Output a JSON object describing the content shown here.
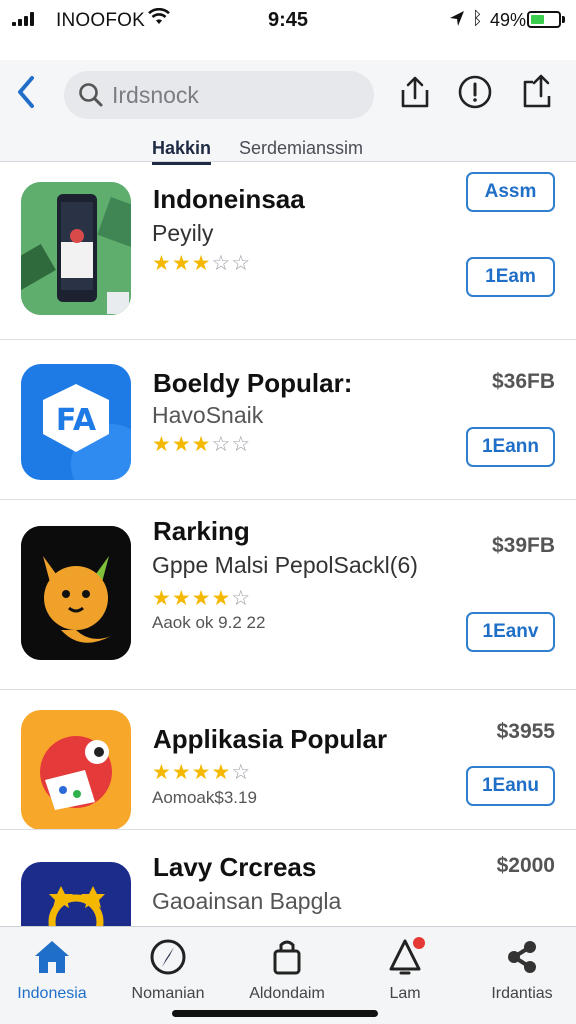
{
  "status_bar": {
    "carrier": "INOOFOK",
    "time": "9:45",
    "battery_pct": "49%",
    "battery_level": 0.49
  },
  "nav": {
    "search_value": "Irdsnock"
  },
  "tabs": [
    {
      "label": "Hakkin",
      "active": true
    },
    {
      "label": "Serdemianssim",
      "active": false
    }
  ],
  "apps": [
    {
      "title": "Indoneinsaa",
      "subtitle": "Peyily",
      "rating": 3,
      "meta": "",
      "price": "",
      "buttons": [
        "Assm",
        "1Eam"
      ]
    },
    {
      "title": "Boeldy Popular:",
      "subtitle": "HavoSnaik",
      "rating": 3,
      "meta": "",
      "price": "$36FB",
      "buttons": [
        "1Eann"
      ]
    },
    {
      "title": "Rarking",
      "subtitle": "Gppe Malsi PepolSackl(6)",
      "rating": 4,
      "meta": "Aaok ok 9.2 22",
      "price": "$39FB",
      "buttons": [
        "1Eanv"
      ]
    },
    {
      "title": "Applikasia Popular",
      "subtitle": "",
      "rating": 4,
      "meta": "Aomoak$3.19",
      "price": "$3955",
      "buttons": [
        "1Eanu"
      ]
    },
    {
      "title": "Lavy Crcreas",
      "subtitle": "Gaoainsan Bapgla",
      "rating": 0,
      "meta": "",
      "price": "$2000",
      "buttons": []
    }
  ],
  "tabbar": [
    {
      "label": "Indonesia",
      "icon": "home-icon",
      "active": true
    },
    {
      "label": "Nomanian",
      "icon": "compass-icon",
      "active": false
    },
    {
      "label": "Aldondaim",
      "icon": "bag-icon",
      "active": false
    },
    {
      "label": "Lam",
      "icon": "bell-icon",
      "active": false,
      "badge": true
    },
    {
      "label": "Irdantias",
      "icon": "share-icon",
      "active": false
    }
  ],
  "colors": {
    "accent": "#1f6fc8",
    "star": "#f5b800",
    "badge": "#e53935"
  }
}
